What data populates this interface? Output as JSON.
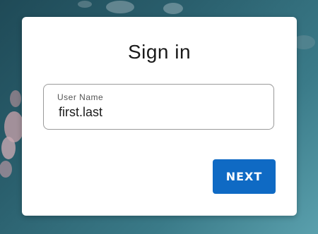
{
  "signin": {
    "title": "Sign in",
    "username": {
      "label": "User Name",
      "value": "first.last"
    },
    "next_label": "NEXT"
  },
  "colors": {
    "primary": "#0f6ac4",
    "background": "#2a5f6d",
    "card": "#ffffff"
  }
}
